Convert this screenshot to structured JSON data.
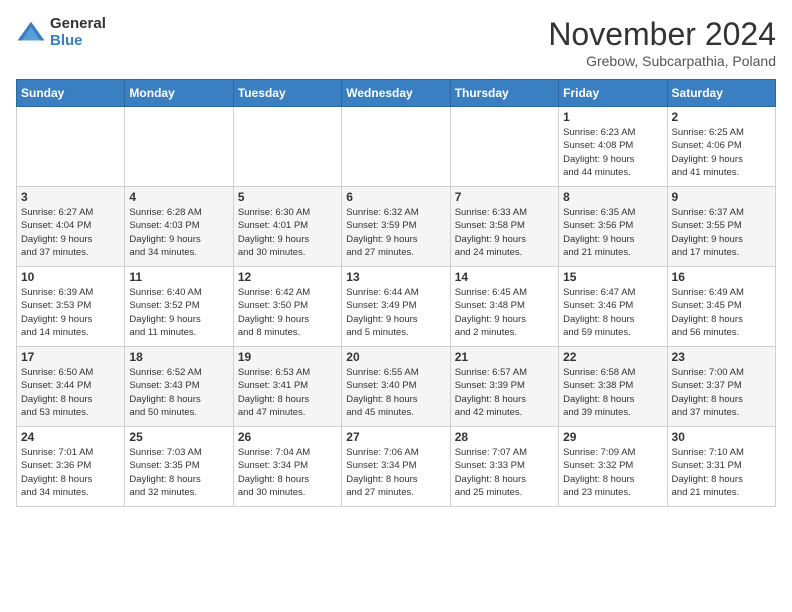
{
  "logo": {
    "general": "General",
    "blue": "Blue"
  },
  "title": "November 2024",
  "subtitle": "Grebow, Subcarpathia, Poland",
  "days_of_week": [
    "Sunday",
    "Monday",
    "Tuesday",
    "Wednesday",
    "Thursday",
    "Friday",
    "Saturday"
  ],
  "weeks": [
    [
      {
        "day": "",
        "info": ""
      },
      {
        "day": "",
        "info": ""
      },
      {
        "day": "",
        "info": ""
      },
      {
        "day": "",
        "info": ""
      },
      {
        "day": "",
        "info": ""
      },
      {
        "day": "1",
        "info": "Sunrise: 6:23 AM\nSunset: 4:08 PM\nDaylight: 9 hours\nand 44 minutes."
      },
      {
        "day": "2",
        "info": "Sunrise: 6:25 AM\nSunset: 4:06 PM\nDaylight: 9 hours\nand 41 minutes."
      }
    ],
    [
      {
        "day": "3",
        "info": "Sunrise: 6:27 AM\nSunset: 4:04 PM\nDaylight: 9 hours\nand 37 minutes."
      },
      {
        "day": "4",
        "info": "Sunrise: 6:28 AM\nSunset: 4:03 PM\nDaylight: 9 hours\nand 34 minutes."
      },
      {
        "day": "5",
        "info": "Sunrise: 6:30 AM\nSunset: 4:01 PM\nDaylight: 9 hours\nand 30 minutes."
      },
      {
        "day": "6",
        "info": "Sunrise: 6:32 AM\nSunset: 3:59 PM\nDaylight: 9 hours\nand 27 minutes."
      },
      {
        "day": "7",
        "info": "Sunrise: 6:33 AM\nSunset: 3:58 PM\nDaylight: 9 hours\nand 24 minutes."
      },
      {
        "day": "8",
        "info": "Sunrise: 6:35 AM\nSunset: 3:56 PM\nDaylight: 9 hours\nand 21 minutes."
      },
      {
        "day": "9",
        "info": "Sunrise: 6:37 AM\nSunset: 3:55 PM\nDaylight: 9 hours\nand 17 minutes."
      }
    ],
    [
      {
        "day": "10",
        "info": "Sunrise: 6:39 AM\nSunset: 3:53 PM\nDaylight: 9 hours\nand 14 minutes."
      },
      {
        "day": "11",
        "info": "Sunrise: 6:40 AM\nSunset: 3:52 PM\nDaylight: 9 hours\nand 11 minutes."
      },
      {
        "day": "12",
        "info": "Sunrise: 6:42 AM\nSunset: 3:50 PM\nDaylight: 9 hours\nand 8 minutes."
      },
      {
        "day": "13",
        "info": "Sunrise: 6:44 AM\nSunset: 3:49 PM\nDaylight: 9 hours\nand 5 minutes."
      },
      {
        "day": "14",
        "info": "Sunrise: 6:45 AM\nSunset: 3:48 PM\nDaylight: 9 hours\nand 2 minutes."
      },
      {
        "day": "15",
        "info": "Sunrise: 6:47 AM\nSunset: 3:46 PM\nDaylight: 8 hours\nand 59 minutes."
      },
      {
        "day": "16",
        "info": "Sunrise: 6:49 AM\nSunset: 3:45 PM\nDaylight: 8 hours\nand 56 minutes."
      }
    ],
    [
      {
        "day": "17",
        "info": "Sunrise: 6:50 AM\nSunset: 3:44 PM\nDaylight: 8 hours\nand 53 minutes."
      },
      {
        "day": "18",
        "info": "Sunrise: 6:52 AM\nSunset: 3:43 PM\nDaylight: 8 hours\nand 50 minutes."
      },
      {
        "day": "19",
        "info": "Sunrise: 6:53 AM\nSunset: 3:41 PM\nDaylight: 8 hours\nand 47 minutes."
      },
      {
        "day": "20",
        "info": "Sunrise: 6:55 AM\nSunset: 3:40 PM\nDaylight: 8 hours\nand 45 minutes."
      },
      {
        "day": "21",
        "info": "Sunrise: 6:57 AM\nSunset: 3:39 PM\nDaylight: 8 hours\nand 42 minutes."
      },
      {
        "day": "22",
        "info": "Sunrise: 6:58 AM\nSunset: 3:38 PM\nDaylight: 8 hours\nand 39 minutes."
      },
      {
        "day": "23",
        "info": "Sunrise: 7:00 AM\nSunset: 3:37 PM\nDaylight: 8 hours\nand 37 minutes."
      }
    ],
    [
      {
        "day": "24",
        "info": "Sunrise: 7:01 AM\nSunset: 3:36 PM\nDaylight: 8 hours\nand 34 minutes."
      },
      {
        "day": "25",
        "info": "Sunrise: 7:03 AM\nSunset: 3:35 PM\nDaylight: 8 hours\nand 32 minutes."
      },
      {
        "day": "26",
        "info": "Sunrise: 7:04 AM\nSunset: 3:34 PM\nDaylight: 8 hours\nand 30 minutes."
      },
      {
        "day": "27",
        "info": "Sunrise: 7:06 AM\nSunset: 3:34 PM\nDaylight: 8 hours\nand 27 minutes."
      },
      {
        "day": "28",
        "info": "Sunrise: 7:07 AM\nSunset: 3:33 PM\nDaylight: 8 hours\nand 25 minutes."
      },
      {
        "day": "29",
        "info": "Sunrise: 7:09 AM\nSunset: 3:32 PM\nDaylight: 8 hours\nand 23 minutes."
      },
      {
        "day": "30",
        "info": "Sunrise: 7:10 AM\nSunset: 3:31 PM\nDaylight: 8 hours\nand 21 minutes."
      }
    ]
  ]
}
